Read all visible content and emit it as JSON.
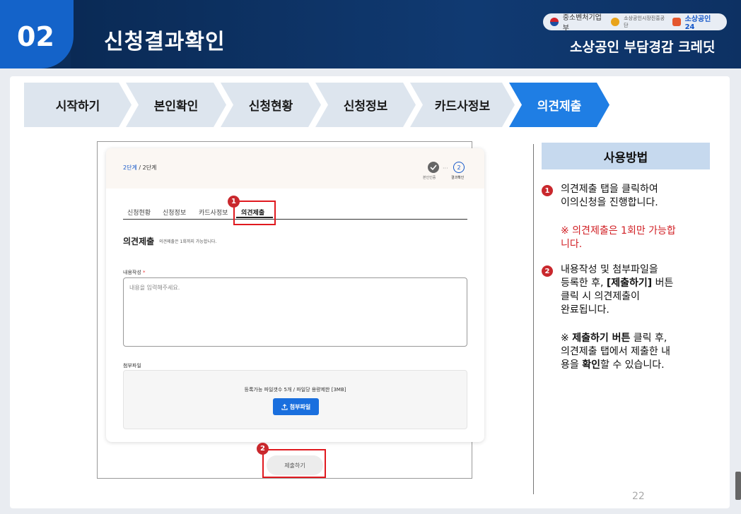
{
  "header": {
    "number": "02",
    "title": "신청결과확인",
    "logos": {
      "ministry": "중소벤처기업부",
      "agency": "소상공인시장진흥공단",
      "portal": "소상공인24"
    },
    "brand_title": "소상공인 부담경감 크레딧"
  },
  "steps": [
    {
      "label": "시작하기",
      "active": false
    },
    {
      "label": "본인확인",
      "active": false
    },
    {
      "label": "신청현황",
      "active": false
    },
    {
      "label": "신청정보",
      "active": false
    },
    {
      "label": "카드사정보",
      "active": false
    },
    {
      "label": "의견제출",
      "active": true
    }
  ],
  "screen": {
    "step_current": "2단계",
    "step_total": "/ 2단계",
    "progress": {
      "check_icon": "check-icon",
      "dots": "···",
      "second_num": "2",
      "label1": "본인인증",
      "label2": "결과확인"
    },
    "tabs": [
      "신청현황",
      "신청정보",
      "카드사정보",
      "의견제출"
    ],
    "section_title": "의견제출",
    "section_sub": "의견제출은 1회까지 가능합니다.",
    "content_label": "내용작성",
    "required_mark": "*",
    "textarea_placeholder": "내용을 입력해주세요.",
    "attach_label": "첨부파일",
    "attach_info": "등록가능 파일갯수 5개 / 파일당 용량제한 [3MB]",
    "attach_button": "첨부파일",
    "submit_button": "제출하기"
  },
  "markers": [
    "1",
    "2"
  ],
  "panel": {
    "title": "사용방법",
    "item1_num": "1",
    "item1_text_a": "의견제출 탭을 클릭하여",
    "item1_text_b": "이의신청을 진행합니다.",
    "item1_note_a": "※ 의견제출은 1회만 가능합",
    "item1_note_b": "니다.",
    "item2_num": "2",
    "item2_line1": "내용작성 및 첨부파일을",
    "item2_line2a": "등록한 후, ",
    "item2_line2b": "[제출하기]",
    "item2_line2c": " 버튼",
    "item2_line3": "클릭 시 의견제출이",
    "item2_line4": "완료됩니다.",
    "item2_note1a": "※ ",
    "item2_note1b": "제출하기 버튼",
    "item2_note1c": " 클릭 후,",
    "item2_note2": "의견제출 탭에서 제출한 내",
    "item2_note3a": "용을 ",
    "item2_note3b": "확인",
    "item2_note3c": "할 수 있습니다."
  },
  "page_number": "22",
  "colors": {
    "header_navy": "#0b2d5a",
    "accent_blue": "#1463c9",
    "step_active": "#1f7ee4",
    "step_inactive": "#dde5ee",
    "highlight_red": "#e0191f",
    "panel_title_bg": "#c6d9ee"
  }
}
